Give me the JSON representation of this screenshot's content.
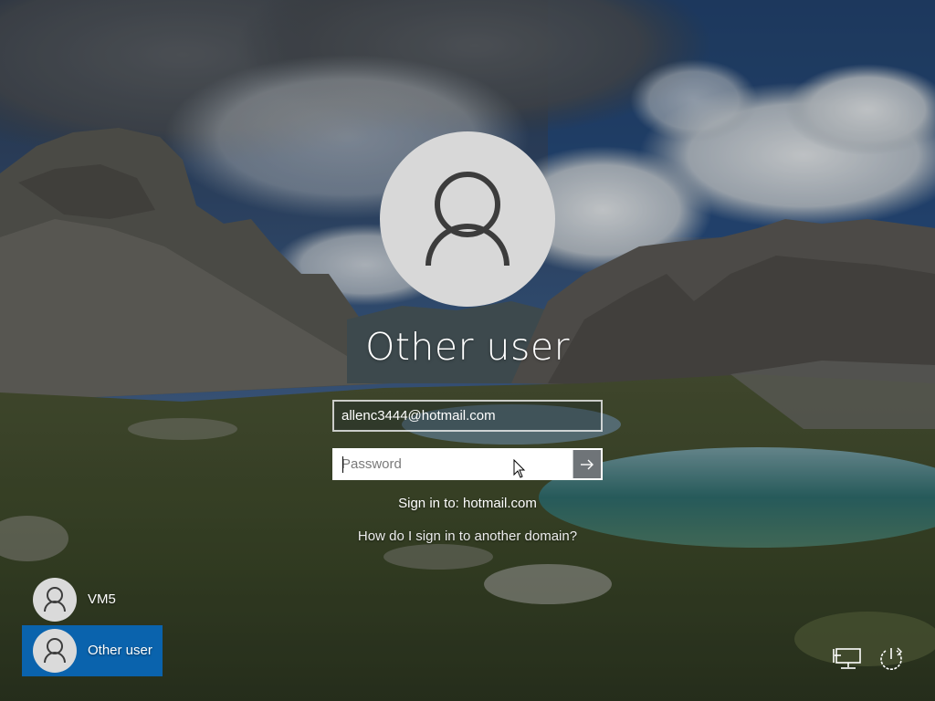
{
  "login": {
    "title": "Other user",
    "username_value": "allenc3444@hotmail.com",
    "password_placeholder": "Password",
    "submit_icon": "arrow-right-icon",
    "sign_in_to": "Sign in to: hotmail.com",
    "domain_help_link": "How do I sign in to another domain?"
  },
  "user_list": [
    {
      "label": "VM5",
      "icon": "user-icon",
      "selected": false
    },
    {
      "label": "Other user",
      "icon": "user-icon",
      "selected": true
    }
  ],
  "corner_buttons": {
    "network_icon": "network-icon",
    "power_icon": "power-icon"
  },
  "colors": {
    "selected_tile": "#0a63ad",
    "avatar_bg": "#d8d8d8",
    "avatar_glyph": "#3c3c3c"
  }
}
